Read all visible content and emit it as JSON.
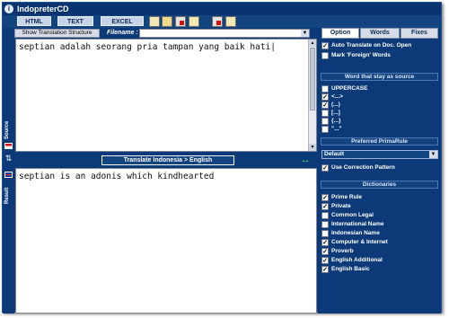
{
  "app": {
    "title": "IndopreterCD"
  },
  "menubar": {
    "tabs": [
      "HTML",
      "TEXT",
      "EXCEL"
    ],
    "tools": [
      "new-file-icon",
      "open-folder-icon",
      "save-icon",
      "print-icon",
      "export-icon",
      "copy-icon"
    ]
  },
  "toolbar": {
    "show_structure_label": "Show Translation Structure",
    "filename_label": "Filename :",
    "filename_value": ""
  },
  "sidebar": {
    "source_label": "Source",
    "result_label": "Result"
  },
  "source": {
    "text": "septian adalah seorang pria tampan yang baik hati|"
  },
  "translate": {
    "label": "Translate Indonesia > English"
  },
  "result": {
    "text": "septian is an adonis which kindhearted"
  },
  "right_panel": {
    "tabs": [
      "Option",
      "Words",
      "Fixes"
    ],
    "auto_translate": {
      "label": "Auto Translate on Doc. Open",
      "checked": true
    },
    "mark_foreign": {
      "label": "Mark 'Foreign' Words",
      "checked": false
    },
    "words_header": "Word that stay as source",
    "words_options": [
      {
        "label": "UPPERCASE",
        "checked": false
      },
      {
        "label": "<...>",
        "checked": true
      },
      {
        "label": "(...)",
        "checked": true
      },
      {
        "label": "[...]",
        "checked": false
      },
      {
        "label": "{...}",
        "checked": false
      },
      {
        "label": "\"...\"",
        "checked": false
      }
    ],
    "primarule_header": "Preferred PrimaRule",
    "primarule_value": "Default",
    "use_correction": {
      "label": "Use Correction Pattern",
      "checked": true
    },
    "dictionaries_header": "Dictionaries",
    "dictionaries": [
      {
        "label": "Prime Rule",
        "checked": true
      },
      {
        "label": "Private",
        "checked": true
      },
      {
        "label": "Common Legal",
        "checked": false
      },
      {
        "label": "International Name",
        "checked": false
      },
      {
        "label": "Indonesian Name",
        "checked": false
      },
      {
        "label": "Computer & Internet",
        "checked": true
      },
      {
        "label": "Proverb",
        "checked": true
      },
      {
        "label": "English Additional",
        "checked": true
      },
      {
        "label": "English Basic",
        "checked": true
      }
    ]
  }
}
